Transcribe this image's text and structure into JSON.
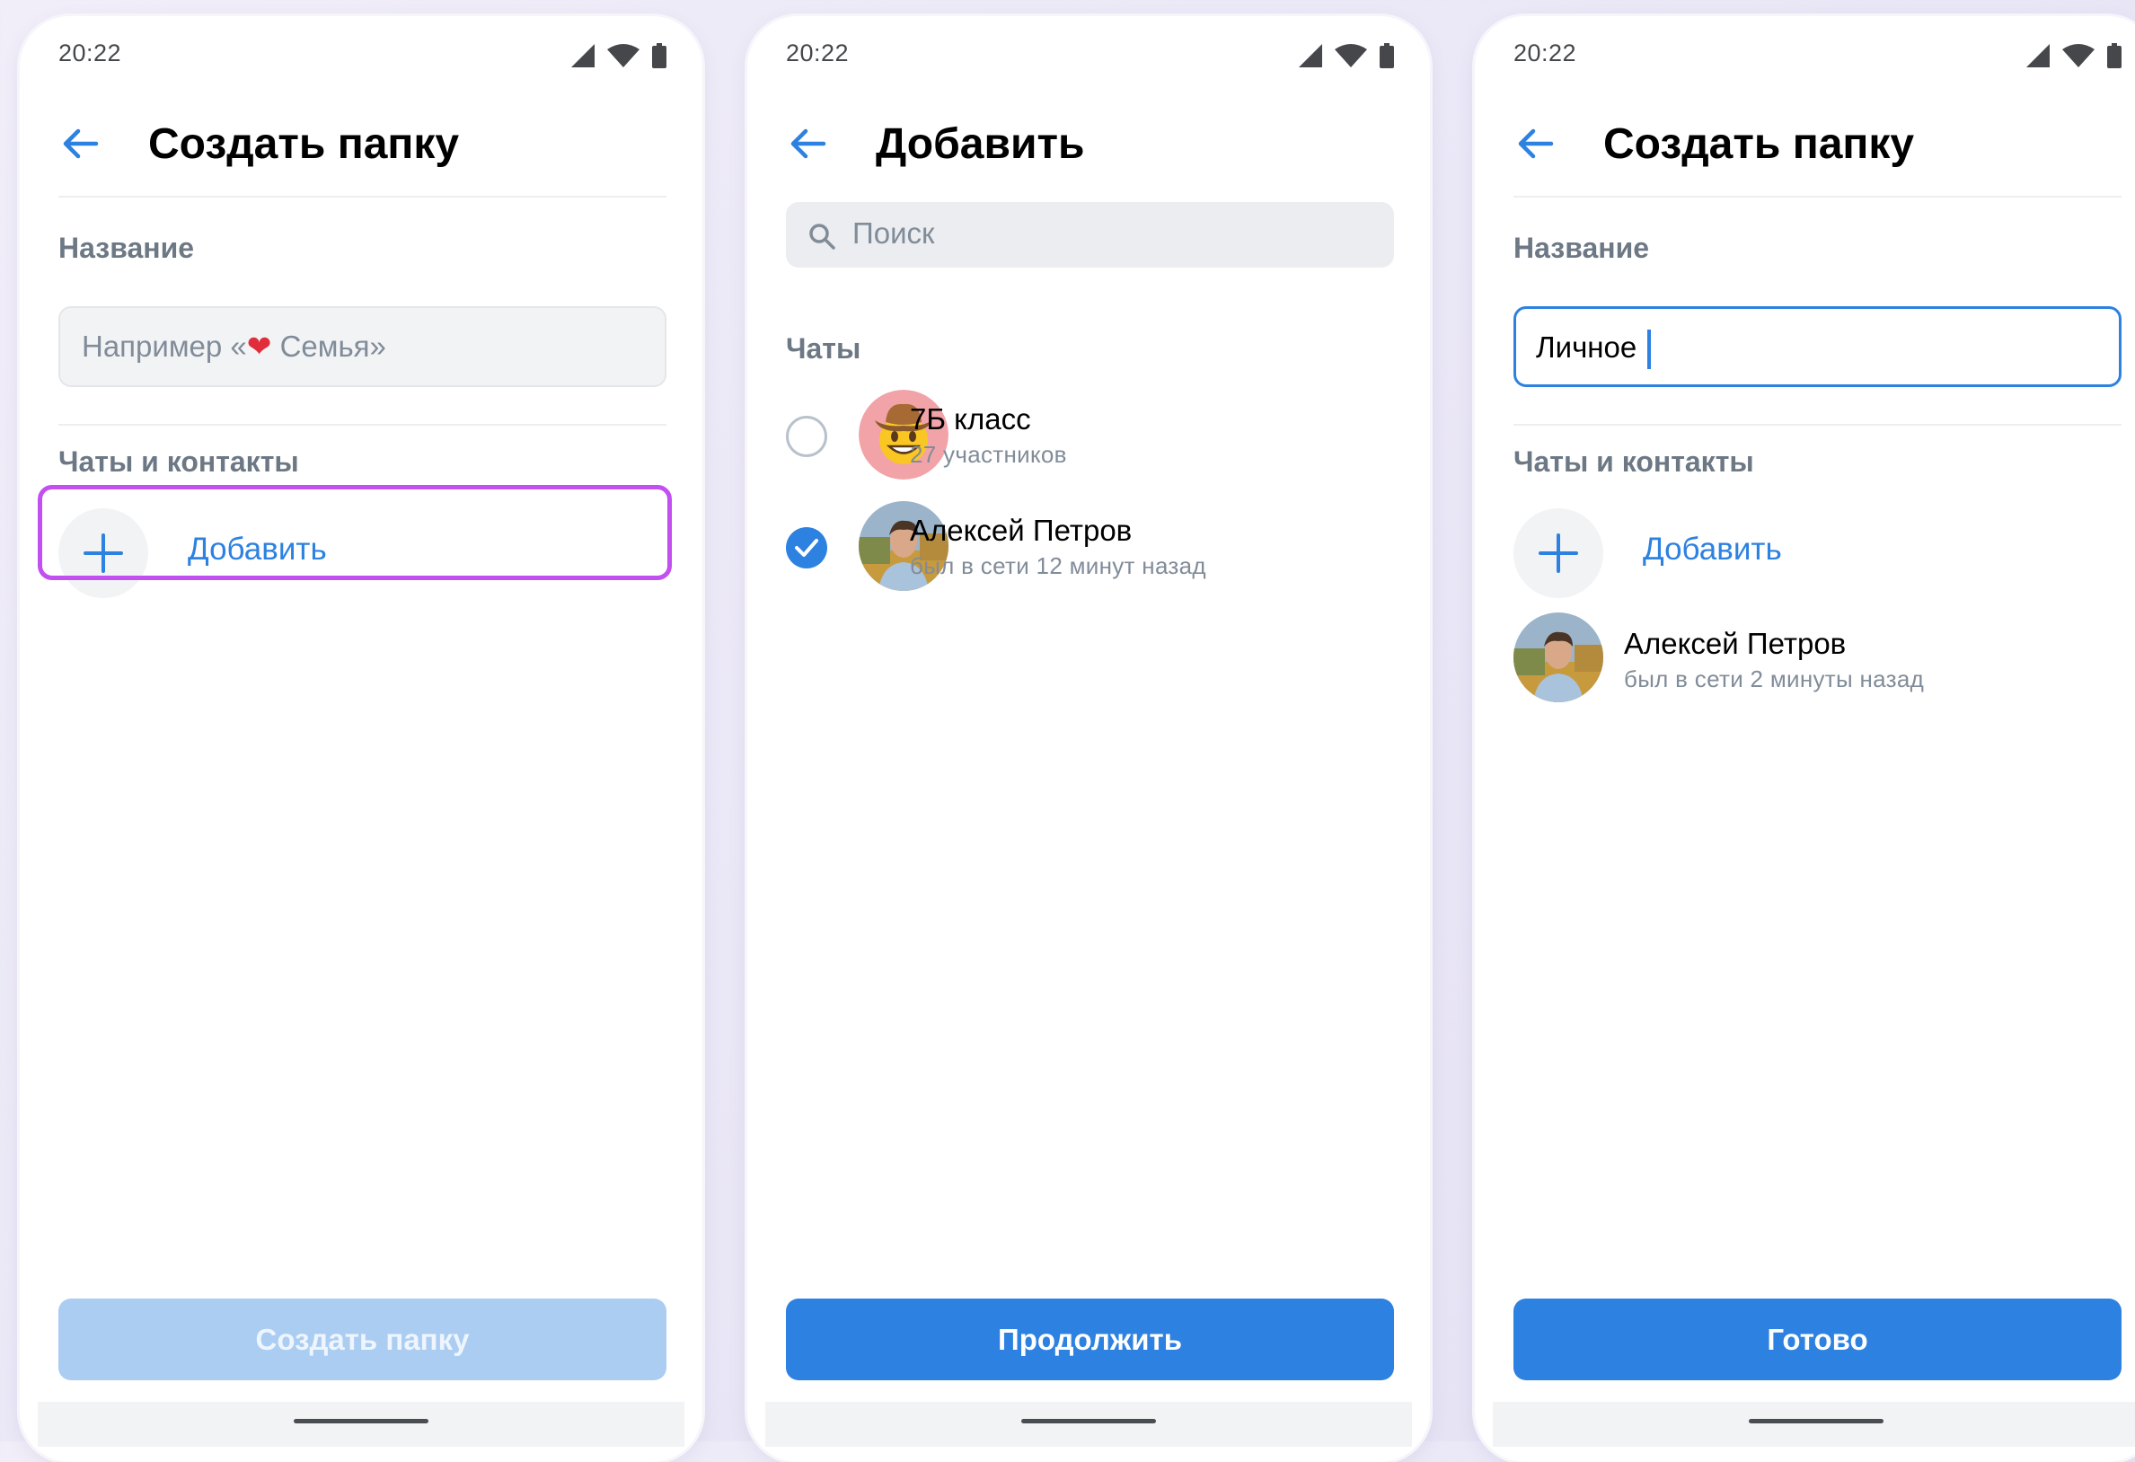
{
  "colors": {
    "accent": "#2d81e0",
    "highlight": "#c24ff0",
    "secondary_text": "#818c99",
    "section_label": "#6d7885",
    "disabled_button": "#abcdf2"
  },
  "screens": [
    {
      "status": {
        "time": "20:22",
        "icons": [
          "signal-icon",
          "wifi-icon",
          "battery-icon"
        ]
      },
      "header": {
        "back_icon": "arrow-left-icon",
        "title": "Создать папку"
      },
      "name_label": "Название",
      "name_input": {
        "value": "",
        "placeholder_before": "Например «",
        "placeholder_emoji": "❤",
        "placeholder_after": " Семья»"
      },
      "contacts_label": "Чаты и контакты",
      "add_label": "Добавить",
      "button_label": "Создать папку",
      "button_state": "disabled"
    },
    {
      "status": {
        "time": "20:22",
        "icons": [
          "signal-icon",
          "wifi-icon",
          "battery-icon"
        ]
      },
      "header": {
        "back_icon": "arrow-left-icon",
        "title": "Добавить"
      },
      "search_placeholder": "Поиск",
      "section_label": "Чаты",
      "items": [
        {
          "name": "7Б класс",
          "subtitle": "27 участников",
          "selected": false,
          "avatar": "cowboy-emoji-avatar"
        },
        {
          "name": "Алексей Петров",
          "subtitle": "был в сети 12 минут назад",
          "selected": true,
          "avatar": "person-photo-avatar"
        }
      ],
      "button_label": "Продолжить",
      "button_state": "enabled"
    },
    {
      "status": {
        "time": "20:22",
        "icons": [
          "signal-icon",
          "wifi-icon",
          "battery-icon"
        ]
      },
      "header": {
        "back_icon": "arrow-left-icon",
        "title": "Создать папку"
      },
      "name_label": "Название",
      "name_input": {
        "value": "Личное"
      },
      "contacts_label": "Чаты и контакты",
      "add_label": "Добавить",
      "contact": {
        "name": "Алексей Петров",
        "subtitle": "был в сети 2 минуты назад",
        "avatar": "person-photo-avatar"
      },
      "button_label": "Готово",
      "button_state": "enabled"
    }
  ]
}
